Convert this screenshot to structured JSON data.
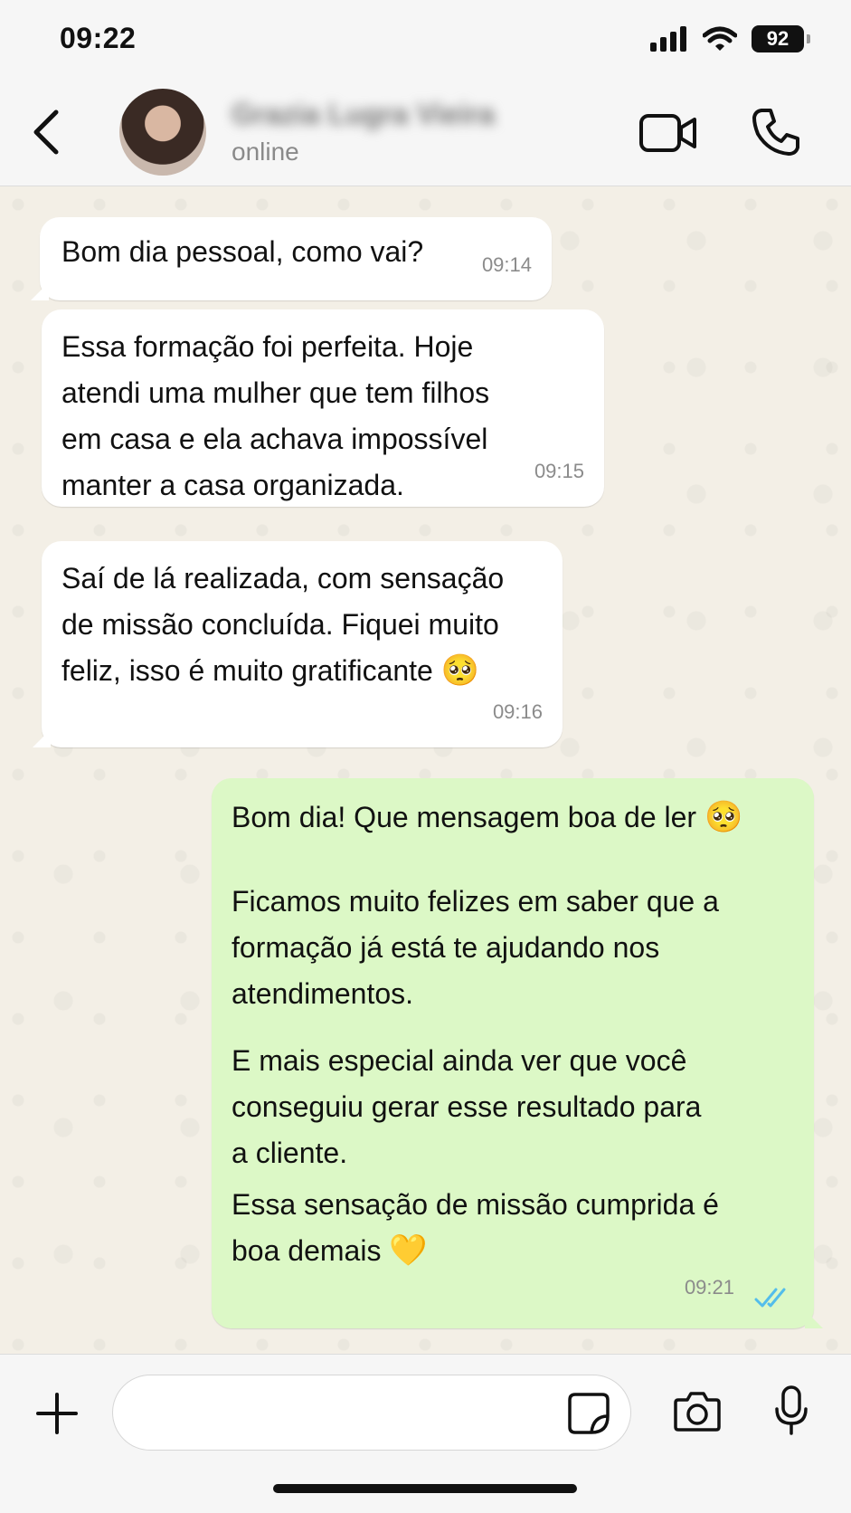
{
  "status_bar": {
    "time": "09:22",
    "battery": "92"
  },
  "header": {
    "contact_name": "Grazia Lugra Vieira",
    "contact_status": "online"
  },
  "messages": [
    {
      "direction": "in",
      "text": "Bom dia pessoal, como vai?",
      "time": "09:14"
    },
    {
      "direction": "in",
      "text": "Essa formação foi perfeita. Hoje\natendi uma mulher que tem filhos\nem casa e ela achava impossível\nmanter a casa organizada.",
      "time": "09:15"
    },
    {
      "direction": "in",
      "text": "Saí de lá realizada, com sensação\nde missão concluída. Fiquei muito\nfeliz, isso é muito gratificante",
      "emoji": "🥺",
      "time": "09:16"
    },
    {
      "direction": "out",
      "paragraphs": [
        "Bom dia! Que mensagem boa de ler",
        "Ficamos muito felizes em saber que a\nformação já está te ajudando nos\natendimentos.",
        "E mais especial ainda ver que você\nconseguiu gerar esse resultado para\na cliente.",
        "Essa sensação de missão cumprida é\nboa demais"
      ],
      "emoji_1": "🥺",
      "emoji_4": "💛",
      "time": "09:21",
      "read_status": "double-check-read"
    }
  ],
  "input": {
    "placeholder": ""
  },
  "colors": {
    "incoming_bubble": "#ffffff",
    "outgoing_bubble": "#dcf8c6",
    "read_ticks": "#53bdeb"
  }
}
